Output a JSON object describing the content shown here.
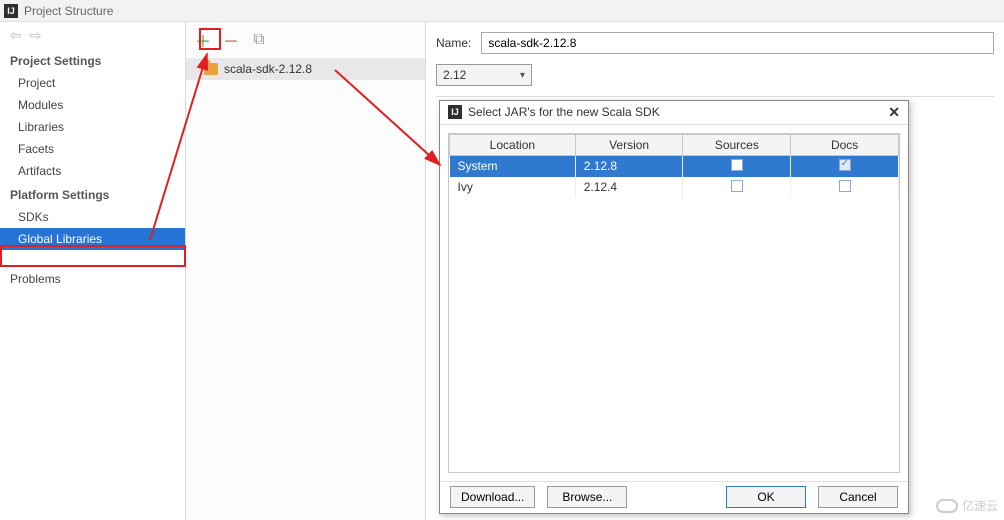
{
  "window": {
    "title": "Project Structure"
  },
  "sidebar": {
    "sections": [
      {
        "title": "Project Settings",
        "items": [
          {
            "label": "Project"
          },
          {
            "label": "Modules"
          },
          {
            "label": "Libraries"
          },
          {
            "label": "Facets"
          },
          {
            "label": "Artifacts"
          }
        ]
      },
      {
        "title": "Platform Settings",
        "items": [
          {
            "label": "SDKs"
          },
          {
            "label": "Global Libraries",
            "selected": true
          }
        ]
      }
    ],
    "problems": {
      "label": "Problems"
    }
  },
  "libraries": {
    "items": [
      {
        "label": "scala-sdk-2.12.8"
      }
    ]
  },
  "details": {
    "name_label": "Name:",
    "name_value": "scala-sdk-2.12.8",
    "version_combo": "2.12"
  },
  "dialog": {
    "title": "Select JAR's for the new Scala SDK",
    "columns": [
      "Location",
      "Version",
      "Sources",
      "Docs"
    ],
    "rows": [
      {
        "location": "System",
        "version": "2.12.8",
        "sources": false,
        "docs": true,
        "selected": true
      },
      {
        "location": "Ivy",
        "version": "2.12.4",
        "sources": false,
        "docs": false,
        "selected": false
      }
    ],
    "buttons": {
      "download": "Download...",
      "browse": "Browse...",
      "ok": "OK",
      "cancel": "Cancel"
    }
  },
  "watermark": "亿速云"
}
